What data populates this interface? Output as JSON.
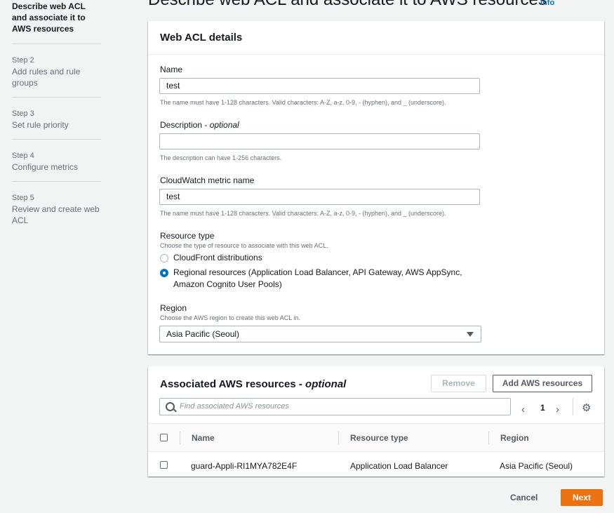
{
  "steps": [
    {
      "number": "",
      "title": "Describe web ACL and associate it to AWS resources",
      "active": true
    },
    {
      "number": "Step 2",
      "title": "Add rules and rule groups"
    },
    {
      "number": "Step 3",
      "title": "Set rule priority"
    },
    {
      "number": "Step 4",
      "title": "Configure metrics"
    },
    {
      "number": "Step 5",
      "title": "Review and create web ACL"
    }
  ],
  "page_title": "Describe web ACL and associate it to AWS resources",
  "info_link": "Info",
  "details": {
    "title": "Web ACL details",
    "name_label": "Name",
    "name_value": "test",
    "name_hint": "The name must have 1-128 characters. Valid characters: A-Z, a-z, 0-9, - (hyphen), and _ (underscore).",
    "desc_label": "Description - ",
    "desc_optional": "optional",
    "desc_value": "",
    "desc_hint": "The description can have 1-256 characters.",
    "metric_label": "CloudWatch metric name",
    "metric_value": "test",
    "metric_hint": "The name must have 1-128 characters. Valid characters: A-Z, a-z, 0-9, - (hyphen), and _ (underscore).",
    "resource_type_label": "Resource type",
    "resource_type_hint": "Choose the type of resource to associate with this web ACL.",
    "resource_options": [
      {
        "label": "CloudFront distributions",
        "selected": false
      },
      {
        "label": "Regional resources (Application Load Balancer, API Gateway, AWS AppSync, Amazon Cognito User Pools)",
        "selected": true
      }
    ],
    "region_label": "Region",
    "region_hint": "Choose the AWS region to create this web ACL in.",
    "region_value": "Asia Pacific (Seoul)"
  },
  "resources": {
    "title": "Associated AWS resources - ",
    "title_optional": "optional",
    "remove_label": "Remove",
    "add_label": "Add AWS resources",
    "search_placeholder": "Find associated AWS resources",
    "page": "1",
    "columns": [
      "Name",
      "Resource type",
      "Region"
    ],
    "rows": [
      {
        "name": "guard-Appli-RI1MYA782E4F",
        "type": "Application Load Balancer",
        "region": "Asia Pacific (Seoul)"
      }
    ]
  },
  "footer": {
    "cancel_label": "Cancel",
    "next_label": "Next"
  },
  "colors": {
    "accent": "#0073bb",
    "primary_button": "#ec7211"
  }
}
